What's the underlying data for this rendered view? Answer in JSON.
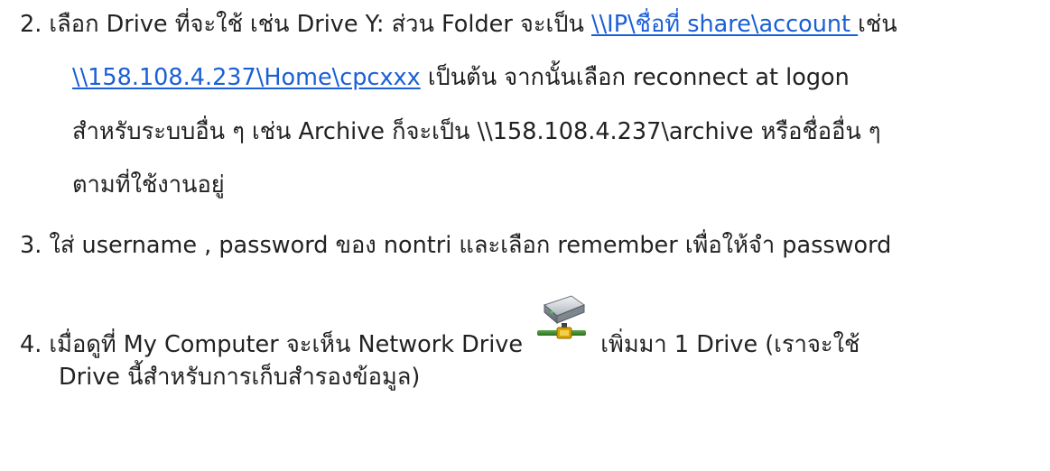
{
  "items": {
    "step2": {
      "line1_a": "2. เลือก Drive ที่จะใช้ เช่น Drive Y: ส่วน Folder จะเป็น ",
      "line1_link": "\\\\IP\\ชื่อที่ share\\account ",
      "line1_b": " เช่น",
      "line2_link": "\\\\158.108.4.237\\Home\\cpcxxx",
      "line2_b": " เป็นต้น จากนั้นเลือก reconnect at logon",
      "line3": "สำหรับระบบอื่น ๆ เช่น Archive ก็จะเป็น \\\\158.108.4.237\\archive หรือชื่ออื่น ๆ",
      "line4": "ตามที่ใช้งานอยู่"
    },
    "step3": {
      "text": "3. ใส่ username , password ของ nontri และเลือก remember เพื่อให้จำ password"
    },
    "step4": {
      "line1_a": "4. เมื่อดูที่ My Computer จะเห็น Network Drive ",
      "icon": "network-drive-icon",
      "line1_b": " เพิ่มมา 1 Drive  (เราจะใช้",
      "line2": "Drive นี้สำหรับการเก็บสำรองข้อมูล)"
    }
  },
  "colors": {
    "text": "#222222",
    "link": "#1a5fd6"
  }
}
